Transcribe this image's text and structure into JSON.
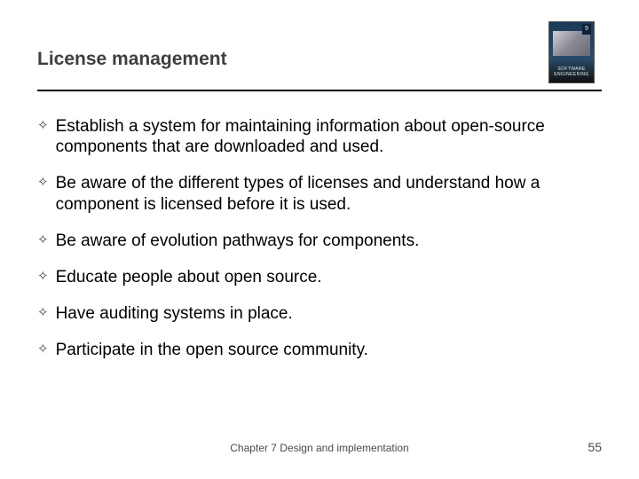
{
  "slide": {
    "title": "License management",
    "bullets": [
      "Establish a system for maintaining information about open-source components that are downloaded and used.",
      "Be aware of the different types of licenses and understand how a component is licensed before it is used.",
      "Be aware of evolution pathways for components.",
      "Educate people about open source.",
      "Have auditing systems in place.",
      "Participate in the open source community."
    ],
    "footer_text": "Chapter 7 Design and implementation",
    "page_number": "55",
    "book_label": "SOFTWARE ENGINEERING",
    "book_edition": "9"
  }
}
